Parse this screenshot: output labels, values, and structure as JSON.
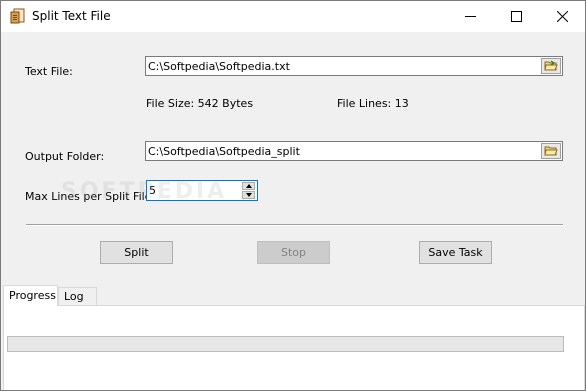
{
  "window": {
    "title": "Split Text File"
  },
  "icons": {
    "app": "text-file-icon",
    "minimize": "minimize-icon",
    "maximize": "maximize-icon",
    "close": "close-icon",
    "folder": "folder-open-icon",
    "spin_up": "arrow-up-icon",
    "spin_down": "arrow-down-icon"
  },
  "form": {
    "text_file_label": "Text File:",
    "text_file_value": "C:\\Softpedia\\Softpedia.txt",
    "file_size_text": "File Size: 542 Bytes",
    "file_lines_text": "File Lines: 13",
    "output_folder_label": "Output Folder:",
    "output_folder_value": "C:\\Softpedia\\Softpedia_split",
    "max_lines_label": "Max Lines per Split File",
    "max_lines_value": "5"
  },
  "buttons": {
    "split": "Split",
    "stop": "Stop",
    "save_task": "Save Task"
  },
  "tabs": [
    {
      "label": "Progress",
      "active": true
    },
    {
      "label": "Log",
      "active": false
    }
  ],
  "progress": {
    "value": 0
  },
  "watermark": "SOFTPEDIA"
}
